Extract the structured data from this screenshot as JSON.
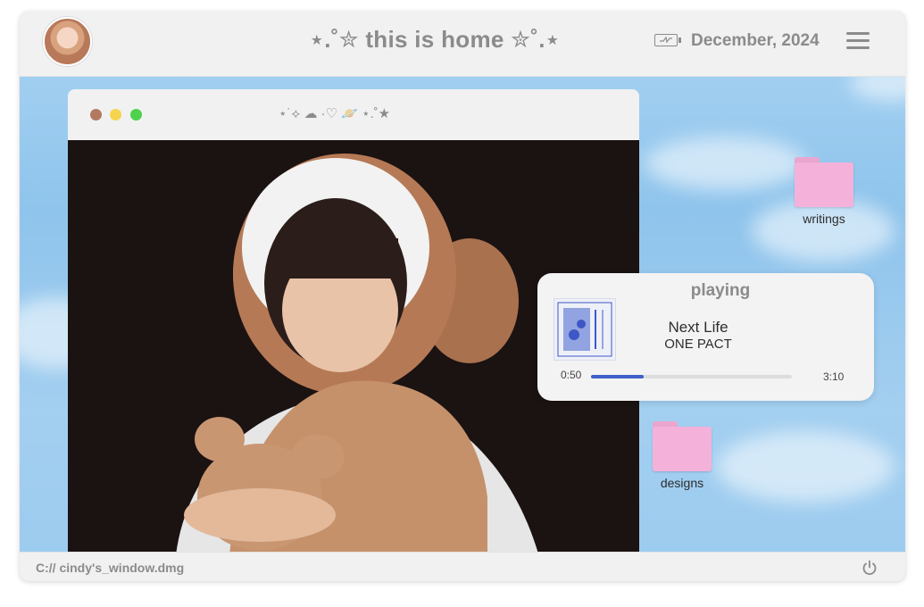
{
  "topbar": {
    "title": "⋆.˚✮ this is home ✮˚.⋆",
    "date": "December, 2024",
    "icons": [
      "avatar",
      "battery-icon",
      "menu-icon"
    ]
  },
  "window": {
    "decoration": "⋆˙⟡ ☁︎ ·♡ 🪐 ⋆.˚★",
    "traffic_lights": [
      "#b17a60",
      "#f5d54e",
      "#4ed14c"
    ]
  },
  "player": {
    "title": "playing",
    "song": "Next Life",
    "artist": "ONE PACT",
    "time_current": "0:50",
    "time_total": "3:10",
    "progress": 0.26
  },
  "desktop": {
    "folders": [
      {
        "label": "writings"
      },
      {
        "label": "designs"
      }
    ]
  },
  "bottombar": {
    "path": "C:// cindy's_window.dmg"
  },
  "colors": {
    "accent": "#3f5fc9",
    "folder": "#f4b2db",
    "text_muted": "#8b8b8b"
  }
}
